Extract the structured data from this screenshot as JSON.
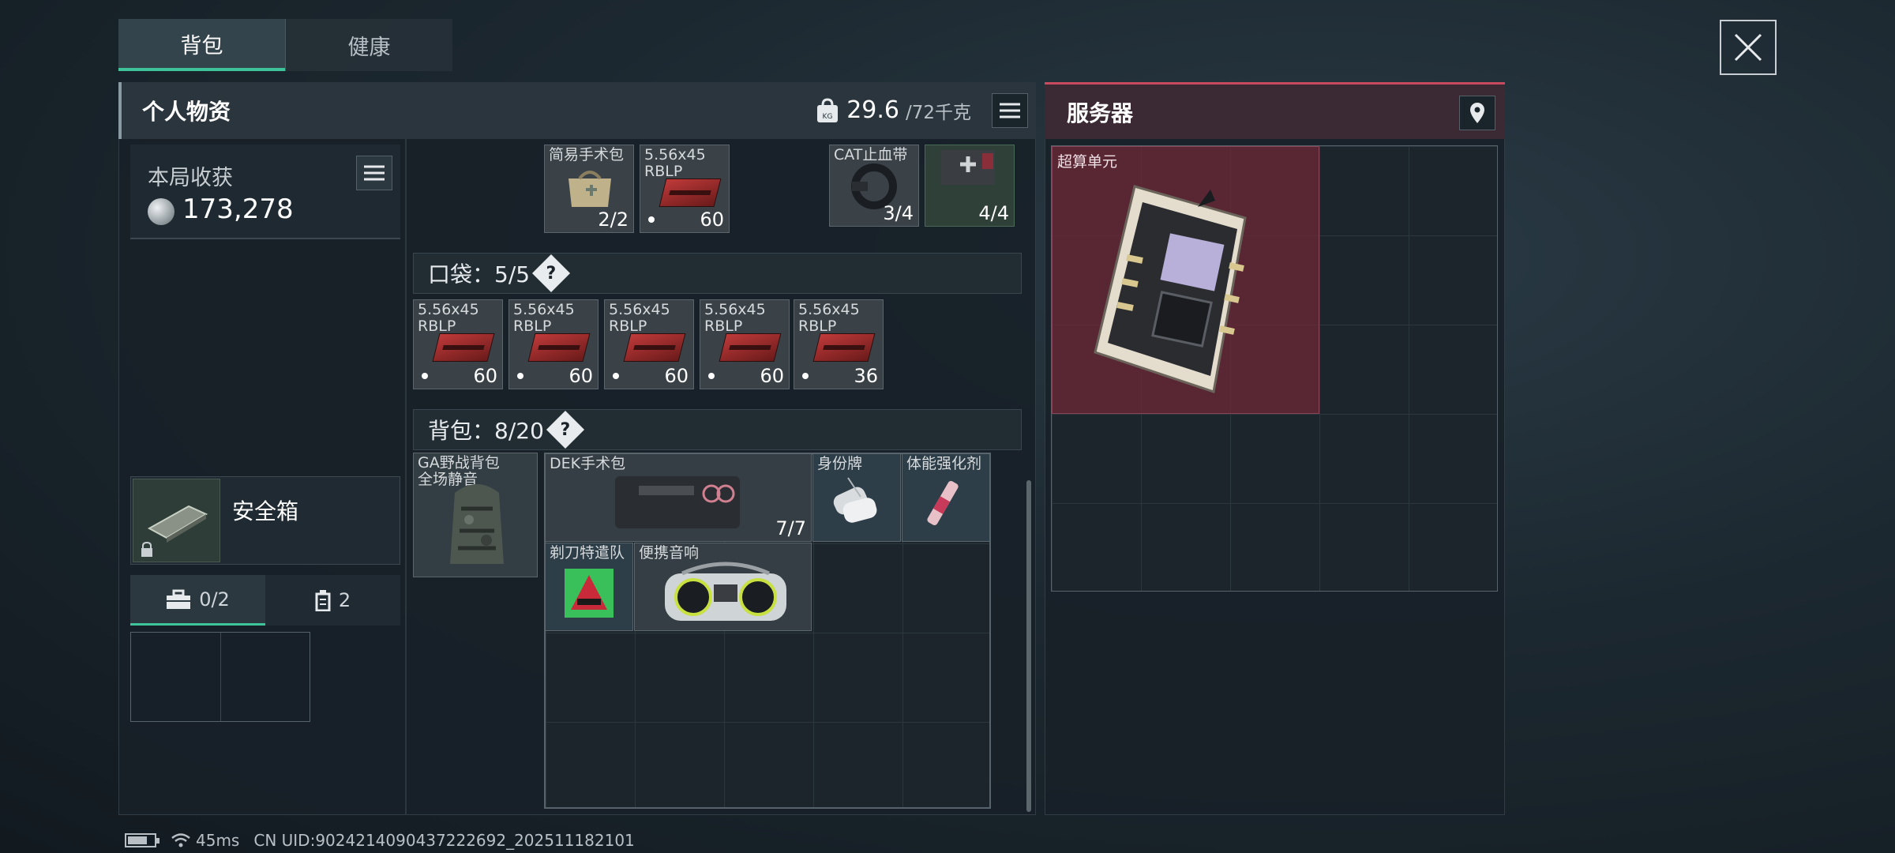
{
  "tabs": [
    {
      "label": "背包"
    },
    {
      "label": "健康"
    }
  ],
  "personal": {
    "title": "个人物资",
    "weight_value": "29.6",
    "weight_capacity": "/72千克"
  },
  "earnings": {
    "label": "本局收获",
    "amount": "173,278"
  },
  "top_items": [
    {
      "name": "简易手术包",
      "count": "2/2"
    },
    {
      "name": "5.56x45\nRBLP",
      "count": "60"
    },
    {
      "name": "CAT止血带",
      "count": "3/4"
    },
    {
      "name": "",
      "count": "4/4"
    }
  ],
  "pocket": {
    "label": "口袋：5/5",
    "items": [
      {
        "name": "5.56x45\nRBLP",
        "count": "60"
      },
      {
        "name": "5.56x45\nRBLP",
        "count": "60"
      },
      {
        "name": "5.56x45\nRBLP",
        "count": "60"
      },
      {
        "name": "5.56x45\nRBLP",
        "count": "60"
      },
      {
        "name": "5.56x45\nRBLP",
        "count": "36"
      }
    ]
  },
  "backpack": {
    "label": "背包：8/20",
    "bag_name": "GA野战背包\n全场静音",
    "items": [
      {
        "name": "DEK手术包",
        "count": "7/7"
      },
      {
        "name": "身份牌",
        "count": ""
      },
      {
        "name": "体能强化剂",
        "count": ""
      },
      {
        "name": "剃刀特遣队",
        "count": ""
      },
      {
        "name": "便携音响",
        "count": ""
      }
    ]
  },
  "safe": {
    "name": "安全箱",
    "slots_label": "0/2",
    "count_label": "2"
  },
  "server": {
    "title": "服务器",
    "item_name": "超算单元"
  },
  "status": {
    "ping": "45ms",
    "uid": "CN UID:9024214090437222692_202511182101"
  },
  "icons": [
    "close-icon",
    "weight-icon",
    "list-icon",
    "coin-icon",
    "location-pin-icon",
    "help-icon",
    "lock-icon",
    "toolbox-icon",
    "battery-icon",
    "wifi-icon"
  ],
  "colors": {
    "accent": "#3fc39a",
    "server_accent": "#c84a5e"
  }
}
